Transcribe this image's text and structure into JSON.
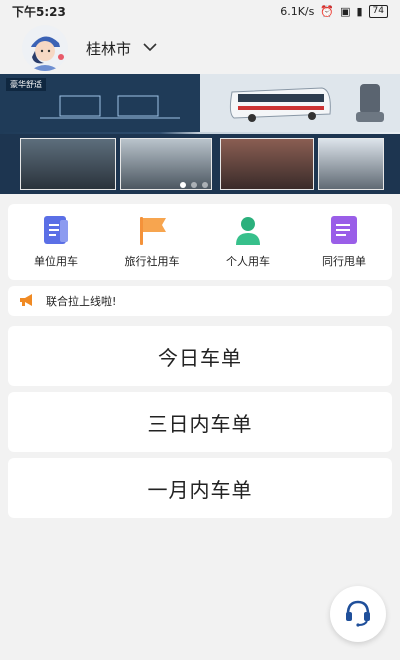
{
  "status_bar": {
    "time": "下午5:23",
    "network_speed": "6.1K/s",
    "battery": "74"
  },
  "header": {
    "city": "桂林市"
  },
  "banner": {
    "logo_text": "豪华舒适",
    "active_slide": 1,
    "slide_count": 3
  },
  "services": [
    {
      "label": "单位用车",
      "icon": "document-icon",
      "color": "#5b6fe6"
    },
    {
      "label": "旅行社用车",
      "icon": "flag-icon",
      "color": "#f4923a"
    },
    {
      "label": "个人用车",
      "icon": "person-icon",
      "color": "#2bb07c"
    },
    {
      "label": "同行甩单",
      "icon": "list-icon",
      "color": "#9a5ee8"
    }
  ],
  "notice": {
    "text": "联合拉上线啦!"
  },
  "orders": [
    {
      "label": "今日车单"
    },
    {
      "label": "三日内车单"
    },
    {
      "label": "一月内车单"
    }
  ],
  "colors": {
    "background": "#f2f2f2",
    "card": "#ffffff",
    "notice_icon": "#f08a24"
  }
}
